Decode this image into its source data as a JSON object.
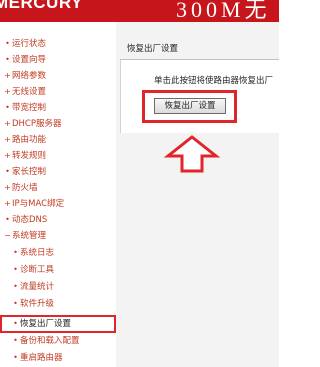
{
  "header": {
    "logo": "MERCURY",
    "model": "300M无"
  },
  "sidebar": {
    "items": [
      {
        "label": "运行状态",
        "sub": false
      },
      {
        "label": "设置向导",
        "sub": false
      },
      {
        "label": "网络参数",
        "sub": false
      },
      {
        "label": "无线设置",
        "sub": false
      },
      {
        "label": "带宽控制",
        "sub": false
      },
      {
        "label": "DHCP服务器",
        "sub": false
      },
      {
        "label": "路由功能",
        "sub": false
      },
      {
        "label": "转发规则",
        "sub": false
      },
      {
        "label": "家长控制",
        "sub": false
      },
      {
        "label": "防火墙",
        "sub": false
      },
      {
        "label": "IP与MAC绑定",
        "sub": false
      },
      {
        "label": "动态DNS",
        "sub": false
      },
      {
        "label": "系统管理",
        "sub": false
      },
      {
        "label": "系统日志",
        "sub": true
      },
      {
        "label": "诊断工具",
        "sub": true
      },
      {
        "label": "流量统计",
        "sub": true
      },
      {
        "label": "软件升级",
        "sub": true
      },
      {
        "label": "恢复出厂设置",
        "sub": true,
        "active": true
      },
      {
        "label": "备份和载入配置",
        "sub": true
      },
      {
        "label": "重启路由器",
        "sub": true
      }
    ]
  },
  "main": {
    "title": "恢复出厂设置",
    "description": "单击此按钮将使路由器恢复出厂",
    "reset_button_label": "恢复出厂设置"
  },
  "colors": {
    "header_red": "#c7161b",
    "menu_text": "#c23b22",
    "highlight_red": "#e0262b",
    "content_bg": "#f3f3f3"
  }
}
